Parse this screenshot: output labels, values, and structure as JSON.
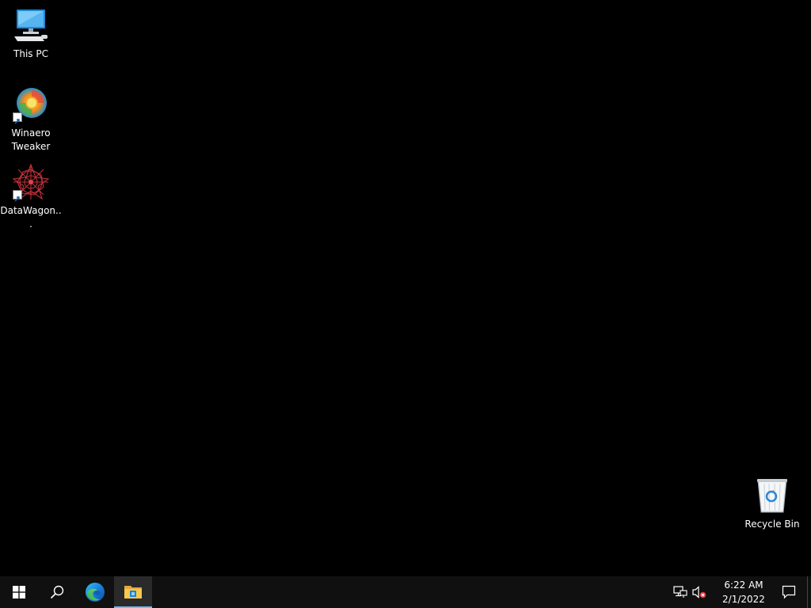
{
  "desktop": {
    "background": "#000000",
    "icons": [
      {
        "label": "This PC",
        "icon": "this-pc-icon"
      },
      {
        "label": "Winaero Tweaker",
        "icon": "winaero-tweaker-icon"
      },
      {
        "label": "DataWagon...",
        "icon": "datawagon-icon"
      },
      {
        "label": "Recycle Bin",
        "icon": "recycle-bin-icon"
      }
    ]
  },
  "taskbar": {
    "background": "#101010",
    "buttons": [
      {
        "name": "start",
        "icon": "windows-logo-icon"
      },
      {
        "name": "search",
        "icon": "search-icon"
      },
      {
        "name": "edge",
        "icon": "edge-icon"
      },
      {
        "name": "file-explorer",
        "icon": "folder-icon",
        "active": true
      }
    ],
    "tray": {
      "icons": [
        "network-icon",
        "volume-muted-icon"
      ],
      "time": "6:22 AM",
      "date": "2/1/2022",
      "notification_icon": "action-center-icon"
    }
  }
}
